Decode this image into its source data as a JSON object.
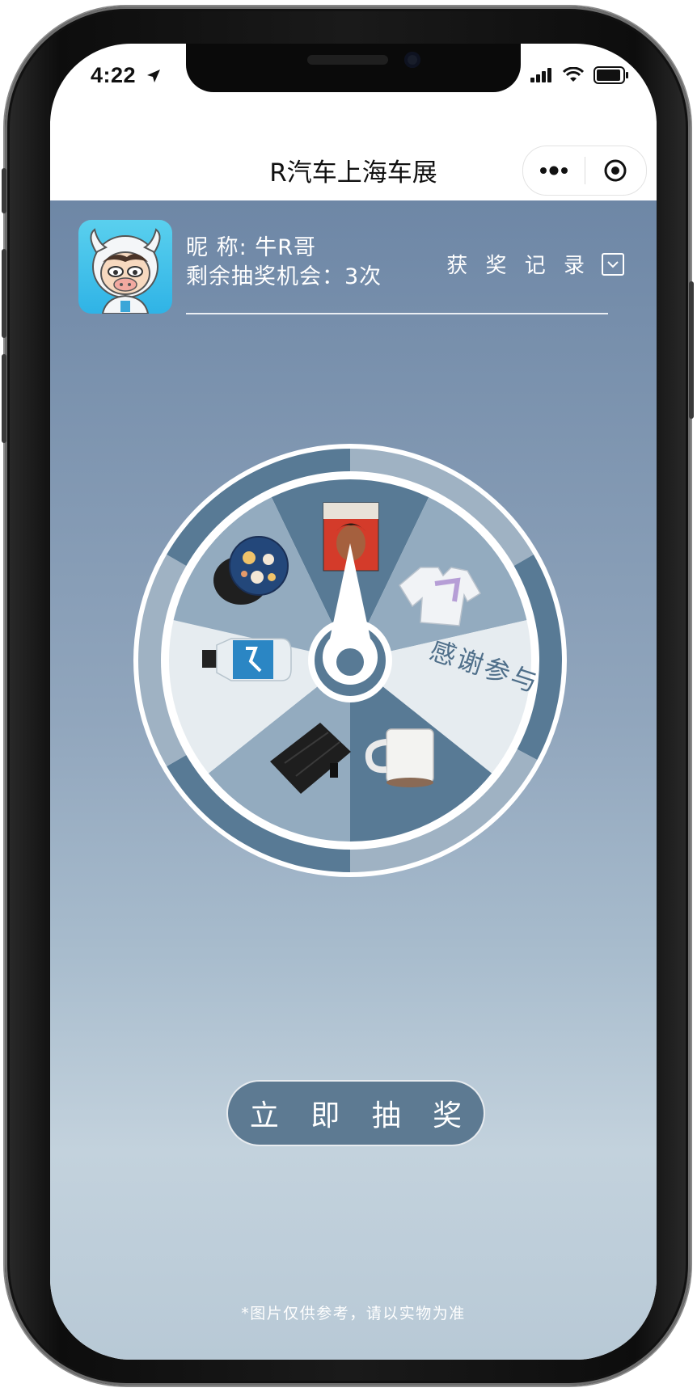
{
  "status": {
    "time": "4:22"
  },
  "navbar": {
    "title": "R汽车上海车展"
  },
  "user": {
    "nickname_label": "昵 称: 牛R哥",
    "chances_label": "剩余抽奖机会：3次",
    "records_label": "获 奖 记 录"
  },
  "wheel": {
    "no_prize_label": "感谢参与",
    "prizes": [
      "专辑",
      "卫衣",
      "感谢参与",
      "马克杯",
      "雨伞",
      "矿泉水",
      "手机支架"
    ]
  },
  "draw_button": {
    "label": "立 即 抽 奖"
  },
  "footer": {
    "note": "*图片仅供参考，请以实物为准"
  },
  "colors": {
    "wheel_dark": "#587a95",
    "wheel_mid": "#93abbf",
    "wheel_light": "#e6ecf0",
    "rim_dark": "#587a95",
    "rim_light": "#9fb2c3",
    "button": "#5d7a92"
  },
  "icons": [
    "location-arrow-icon",
    "signal-icon",
    "wifi-icon",
    "battery-icon",
    "more-dots-icon",
    "close-target-icon",
    "checkbox-icon"
  ]
}
